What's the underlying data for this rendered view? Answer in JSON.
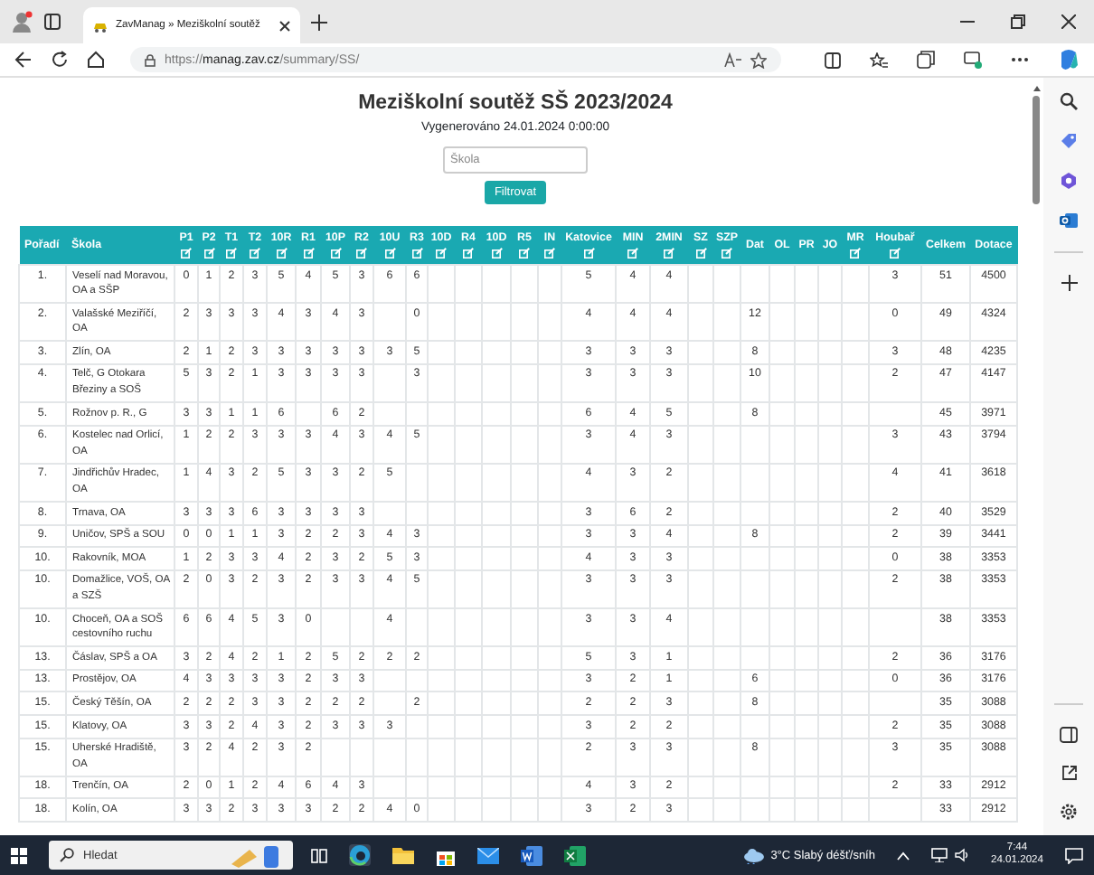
{
  "browser": {
    "tab_title": "ZavManag » Meziškolní soutěž",
    "url_host": "manag.zav.cz",
    "url_scheme": "https://",
    "url_path": "/summary/SS/"
  },
  "page": {
    "title": "Meziškolní soutěž SŠ 2023/2024",
    "generated": "Vygenerováno 24.01.2024 0:00:00",
    "filter": {
      "placeholder": "Škola"
    },
    "filter_button": "Filtrovat"
  },
  "table": {
    "columns": [
      {
        "label": "Pořadí",
        "editable": false
      },
      {
        "label": "Škola",
        "editable": false
      },
      {
        "label": "P1",
        "editable": true
      },
      {
        "label": "P2",
        "editable": true
      },
      {
        "label": "T1",
        "editable": true
      },
      {
        "label": "T2",
        "editable": true
      },
      {
        "label": "10R",
        "editable": true
      },
      {
        "label": "R1",
        "editable": true
      },
      {
        "label": "10P",
        "editable": true
      },
      {
        "label": "R2",
        "editable": true
      },
      {
        "label": "10U",
        "editable": true
      },
      {
        "label": "R3",
        "editable": true
      },
      {
        "label": "10D",
        "editable": true
      },
      {
        "label": "R4",
        "editable": true
      },
      {
        "label": "10D",
        "editable": true
      },
      {
        "label": "R5",
        "editable": true
      },
      {
        "label": "IN",
        "editable": true
      },
      {
        "label": "Katovice",
        "editable": true
      },
      {
        "label": "MIN",
        "editable": true
      },
      {
        "label": "2MIN",
        "editable": true
      },
      {
        "label": "SZ",
        "editable": true
      },
      {
        "label": "SZP",
        "editable": true
      },
      {
        "label": "Dat",
        "editable": false
      },
      {
        "label": "OL",
        "editable": false
      },
      {
        "label": "PR",
        "editable": false
      },
      {
        "label": "JO",
        "editable": false
      },
      {
        "label": "MR",
        "editable": true
      },
      {
        "label": "Houbař",
        "editable": true
      },
      {
        "label": "Celkem",
        "editable": false
      },
      {
        "label": "Dotace",
        "editable": false
      }
    ],
    "rows": [
      {
        "rank": "1.",
        "school": "Veselí nad Moravou, OA a SŠP",
        "p1": "0",
        "p2": "1",
        "t1": "2",
        "t2": "3",
        "r10": "5",
        "r1": "4",
        "p10": "5",
        "r2": "3",
        "u10": "6",
        "r3": "6",
        "katovice": "5",
        "min": "4",
        "min2": "4",
        "houbar": "3",
        "total": "51",
        "grant": "4500"
      },
      {
        "rank": "2.",
        "school": "Valašské Meziříčí, OA",
        "p1": "2",
        "p2": "3",
        "t1": "3",
        "t2": "3",
        "r10": "4",
        "r1": "3",
        "p10": "4",
        "r2": "3",
        "r3": "0",
        "katovice": "4",
        "min": "4",
        "min2": "4",
        "dat": "12",
        "houbar": "0",
        "total": "49",
        "grant": "4324"
      },
      {
        "rank": "3.",
        "school": "Zlín, OA",
        "p1": "2",
        "p2": "1",
        "t1": "2",
        "t2": "3",
        "r10": "3",
        "r1": "3",
        "p10": "3",
        "r2": "3",
        "u10": "3",
        "r3": "5",
        "katovice": "3",
        "min": "3",
        "min2": "3",
        "dat": "8",
        "houbar": "3",
        "total": "48",
        "grant": "4235"
      },
      {
        "rank": "4.",
        "school": "Telč, G Otokara Březiny a SOŠ",
        "p1": "5",
        "p2": "3",
        "t1": "2",
        "t2": "1",
        "r10": "3",
        "r1": "3",
        "p10": "3",
        "r2": "3",
        "r3": "3",
        "katovice": "3",
        "min": "3",
        "min2": "3",
        "dat": "10",
        "houbar": "2",
        "total": "47",
        "grant": "4147"
      },
      {
        "rank": "5.",
        "school": "Rožnov p. R., G",
        "p1": "3",
        "p2": "3",
        "t1": "1",
        "t2": "1",
        "r10": "6",
        "p10": "6",
        "r2": "2",
        "katovice": "6",
        "min": "4",
        "min2": "5",
        "dat": "8",
        "total": "45",
        "grant": "3971"
      },
      {
        "rank": "6.",
        "school": "Kostelec nad Orlicí, OA",
        "p1": "1",
        "p2": "2",
        "t1": "2",
        "t2": "3",
        "r10": "3",
        "r1": "3",
        "p10": "4",
        "r2": "3",
        "u10": "4",
        "r3": "5",
        "katovice": "3",
        "min": "4",
        "min2": "3",
        "houbar": "3",
        "total": "43",
        "grant": "3794"
      },
      {
        "rank": "7.",
        "school": "Jindřichův Hradec, OA",
        "p1": "1",
        "p2": "4",
        "t1": "3",
        "t2": "2",
        "r10": "5",
        "r1": "3",
        "p10": "3",
        "r2": "2",
        "u10": "5",
        "katovice": "4",
        "min": "3",
        "min2": "2",
        "houbar": "4",
        "total": "41",
        "grant": "3618"
      },
      {
        "rank": "8.",
        "school": "Trnava, OA",
        "p1": "3",
        "p2": "3",
        "t1": "3",
        "t2": "6",
        "r10": "3",
        "r1": "3",
        "p10": "3",
        "r2": "3",
        "katovice": "3",
        "min": "6",
        "min2": "2",
        "houbar": "2",
        "total": "40",
        "grant": "3529"
      },
      {
        "rank": "9.",
        "school": "Uničov, SPŠ a SOU",
        "p1": "0",
        "p2": "0",
        "t1": "1",
        "t2": "1",
        "r10": "3",
        "r1": "2",
        "p10": "2",
        "r2": "3",
        "u10": "4",
        "r3": "3",
        "katovice": "3",
        "min": "3",
        "min2": "4",
        "dat": "8",
        "houbar": "2",
        "total": "39",
        "grant": "3441"
      },
      {
        "rank": "10.",
        "school": "Rakovník, MOA",
        "p1": "1",
        "p2": "2",
        "t1": "3",
        "t2": "3",
        "r10": "4",
        "r1": "2",
        "p10": "3",
        "r2": "2",
        "u10": "5",
        "r3": "3",
        "katovice": "4",
        "min": "3",
        "min2": "3",
        "houbar": "0",
        "total": "38",
        "grant": "3353"
      },
      {
        "rank": "10.",
        "school": "Domažlice, VOŠ, OA a SZŠ",
        "p1": "2",
        "p2": "0",
        "t1": "3",
        "t2": "2",
        "r10": "3",
        "r1": "2",
        "p10": "3",
        "r2": "3",
        "u10": "4",
        "r3": "5",
        "katovice": "3",
        "min": "3",
        "min2": "3",
        "houbar": "2",
        "total": "38",
        "grant": "3353"
      },
      {
        "rank": "10.",
        "school": "Choceň, OA a SOŠ cestovního ruchu",
        "p1": "6",
        "p2": "6",
        "t1": "4",
        "t2": "5",
        "r10": "3",
        "r1": "0",
        "u10": "4",
        "katovice": "3",
        "min": "3",
        "min2": "4",
        "total": "38",
        "grant": "3353"
      },
      {
        "rank": "13.",
        "school": "Čáslav, SPŠ a OA",
        "p1": "3",
        "p2": "2",
        "t1": "4",
        "t2": "2",
        "r10": "1",
        "r1": "2",
        "p10": "5",
        "r2": "2",
        "u10": "2",
        "r3": "2",
        "katovice": "5",
        "min": "3",
        "min2": "1",
        "houbar": "2",
        "total": "36",
        "grant": "3176"
      },
      {
        "rank": "13.",
        "school": "Prostějov, OA",
        "p1": "4",
        "p2": "3",
        "t1": "3",
        "t2": "3",
        "r10": "3",
        "r1": "2",
        "p10": "3",
        "r2": "3",
        "katovice": "3",
        "min": "2",
        "min2": "1",
        "dat": "6",
        "houbar": "0",
        "total": "36",
        "grant": "3176"
      },
      {
        "rank": "15.",
        "school": "Český Těšín, OA",
        "p1": "2",
        "p2": "2",
        "t1": "2",
        "t2": "3",
        "r10": "3",
        "r1": "2",
        "p10": "2",
        "r2": "2",
        "r3": "2",
        "katovice": "2",
        "min": "2",
        "min2": "3",
        "dat": "8",
        "total": "35",
        "grant": "3088"
      },
      {
        "rank": "15.",
        "school": "Klatovy, OA",
        "p1": "3",
        "p2": "3",
        "t1": "2",
        "t2": "4",
        "r10": "3",
        "r1": "2",
        "p10": "3",
        "r2": "3",
        "u10": "3",
        "katovice": "3",
        "min": "2",
        "min2": "2",
        "houbar": "2",
        "total": "35",
        "grant": "3088"
      },
      {
        "rank": "15.",
        "school": "Uherské Hradiště, OA",
        "p1": "3",
        "p2": "2",
        "t1": "4",
        "t2": "2",
        "r10": "3",
        "r1": "2",
        "katovice": "2",
        "min": "3",
        "min2": "3",
        "dat": "8",
        "houbar": "3",
        "total": "35",
        "grant": "3088"
      },
      {
        "rank": "18.",
        "school": "Trenčín, OA",
        "p1": "2",
        "p2": "0",
        "t1": "1",
        "t2": "2",
        "r10": "4",
        "r1": "6",
        "p10": "4",
        "r2": "3",
        "katovice": "4",
        "min": "3",
        "min2": "2",
        "houbar": "2",
        "total": "33",
        "grant": "2912"
      },
      {
        "rank": "18.",
        "school": "Kolín, OA",
        "p1": "3",
        "p2": "3",
        "t1": "2",
        "t2": "3",
        "r10": "3",
        "r1": "3",
        "p10": "2",
        "r2": "2",
        "u10": "4",
        "r3": "0",
        "katovice": "3",
        "min": "2",
        "min2": "3",
        "total": "33",
        "grant": "2912"
      }
    ]
  },
  "taskbar": {
    "search_placeholder": "Hledat",
    "weather": "3°C Slabý déšť/sníh",
    "time": "7:44",
    "date": "24.01.2024"
  }
}
